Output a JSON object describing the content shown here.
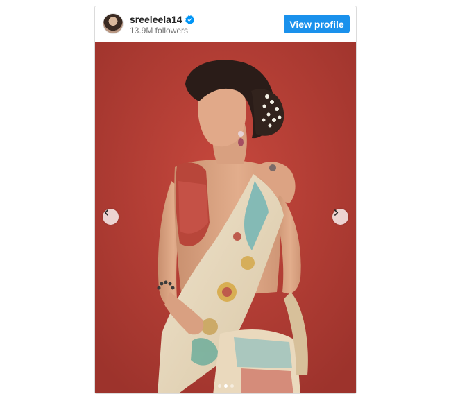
{
  "embed": {
    "username": "sreeleela14",
    "followers": "13.9M followers",
    "view_profile_label": "View profile",
    "verified_icon": "verified-badge-icon",
    "accent_color": "#1a91ec",
    "photo_background_color": "#b63e35"
  },
  "carousel": {
    "prev_icon": "chevron-left-icon",
    "next_icon": "chevron-right-icon",
    "slide_count": 3,
    "active_slide": 2
  }
}
